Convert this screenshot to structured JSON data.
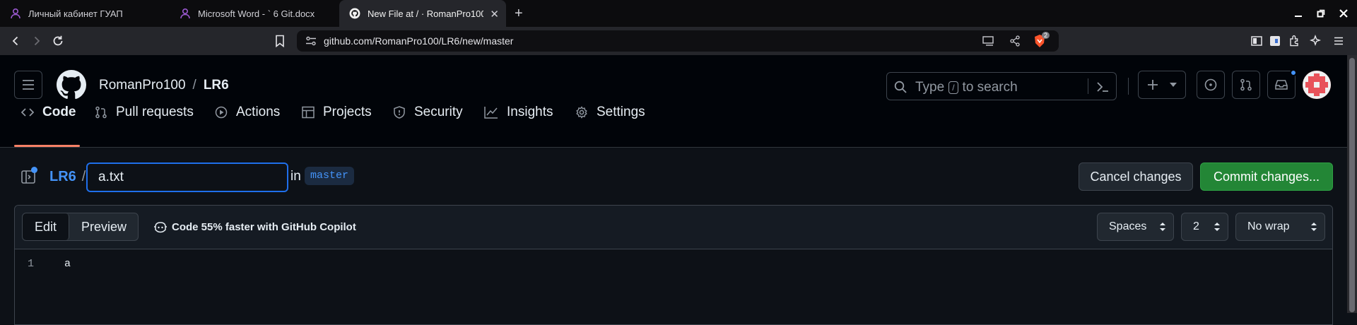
{
  "browser": {
    "tabs": [
      {
        "title": "Личный кабинет ГУАП",
        "favicon": "user-icon"
      },
      {
        "title": "Microsoft Word - ` 6 Git.docx",
        "favicon": "user-icon"
      },
      {
        "title": "New File at / · RomanPro100/LR6",
        "favicon": "github-icon",
        "active": true
      }
    ],
    "url": "github.com/RomanPro100/LR6/new/master",
    "extension_badge": "2"
  },
  "github": {
    "owner": "RomanPro100",
    "separator": "/",
    "repo": "LR6",
    "search": {
      "type_text": "Type",
      "kbd": "/",
      "rest_text": "to search"
    },
    "nav": [
      {
        "label": "Code",
        "icon": "code-icon",
        "selected": true
      },
      {
        "label": "Pull requests",
        "icon": "git-pull-request-icon"
      },
      {
        "label": "Actions",
        "icon": "play-icon"
      },
      {
        "label": "Projects",
        "icon": "table-icon"
      },
      {
        "label": "Security",
        "icon": "shield-icon"
      },
      {
        "label": "Insights",
        "icon": "graph-icon"
      },
      {
        "label": "Settings",
        "icon": "gear-icon"
      }
    ]
  },
  "editor_header": {
    "breadcrumb_repo": "LR6",
    "separator": "/",
    "filename_value": "a.txt",
    "in_label": "in",
    "branch": "master",
    "cancel_label": "Cancel changes",
    "commit_label": "Commit changes..."
  },
  "editor": {
    "tab_edit": "Edit",
    "tab_preview": "Preview",
    "copilot_hint": "Code 55% faster with GitHub Copilot",
    "indent_mode": "Spaces",
    "indent_size": "2",
    "wrap_mode": "No wrap",
    "lines": [
      {
        "number": "1",
        "text": "a"
      }
    ]
  },
  "colors": {
    "accent_blue": "#4493f8",
    "commit_green": "#238636",
    "nav_underline": "#f78166"
  }
}
